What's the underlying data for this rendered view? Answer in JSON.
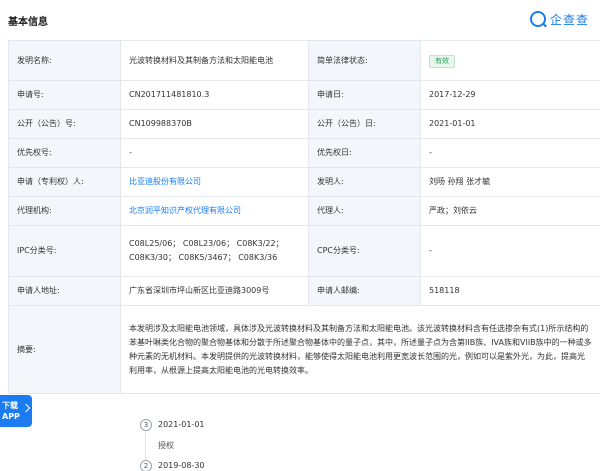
{
  "header": {
    "title": "基本信息",
    "brand": "企查查"
  },
  "rows": {
    "r1": {
      "l1": "发明名称:",
      "v1": "光波转换材料及其制备方法和太阳能电池",
      "l2": "简单法律状态:",
      "badge": "有效"
    },
    "r2": {
      "l1": "申请号:",
      "v1": "CN201711481810.3",
      "l2": "申请日:",
      "v2": "2017-12-29"
    },
    "r3": {
      "l1": "公开（公告）号:",
      "v1": "CN109988370B",
      "l2": "公开（公告）日:",
      "v2": "2021-01-01"
    },
    "r4": {
      "l1": "优先权号:",
      "v1": "-",
      "l2": "优先权日:",
      "v2": "-"
    },
    "r5": {
      "l1": "申请（专利权）人:",
      "v1": "比亚迪股份有限公司",
      "l2": "发明人:",
      "v2": "刘旸 孙翔 张才毓"
    },
    "r6": {
      "l1": "代理机构:",
      "v1": "北京润平知识产权代理有限公司",
      "l2": "代理人:",
      "v2": "严政；刘依云"
    },
    "r7": {
      "l1": "IPC分类号:",
      "v1": "C08L25/06； C08L23/06； C08K3/22； C08K3/30； C08K5/3467； C08K3/36",
      "l2": "CPC分类号:",
      "v2": "-"
    },
    "r8": {
      "l1": "申请人地址:",
      "v1": "广东省深圳市坪山新区比亚迪路3009号",
      "l2": "申请人邮编:",
      "v2": "518118"
    },
    "r9": {
      "l1": "摘要:",
      "v1": "本发明涉及太阳能电池领域，具体涉及光波转换材料及其制备方法和太阳能电池。该光波转换材料含有任选掺杂有式(1)所示结构的苯基叶啉类化合物的聚合物基体和分散于所述聚合物基体中的量子点，其中，所述量子点为含第IIB族、IVA族和VIIB族中的一种或多种元素的无机材料。本发明提供的光波转换材料，能够使得太阳能电池利用更宽波长范围的光，例如可以是紫外光，为此，提高光利用率，从根源上提高太阳能电池的光电转换效率。"
    }
  },
  "timeline": [
    {
      "num": "3",
      "date": "2021-01-01",
      "status": "授权"
    },
    {
      "num": "2",
      "date": "2019-08-30",
      "status": ""
    }
  ],
  "download": {
    "line1": "下载",
    "line2": "APP"
  }
}
